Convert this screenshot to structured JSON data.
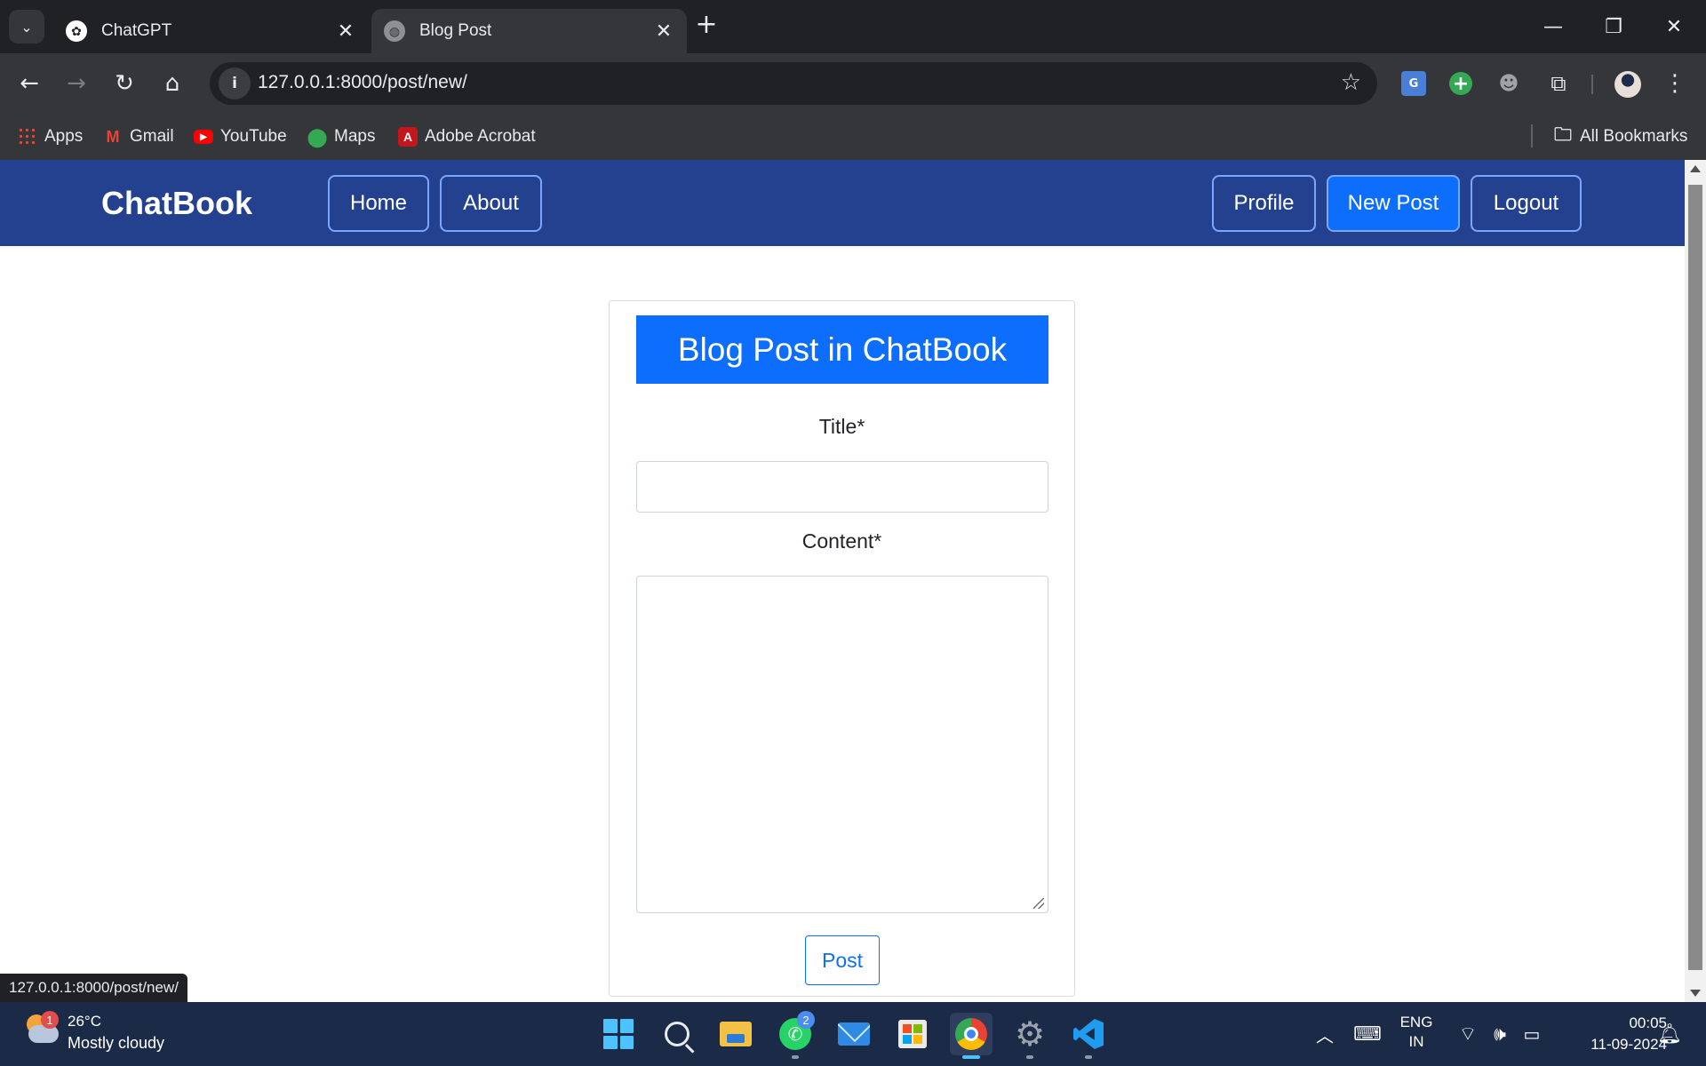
{
  "browser": {
    "tabs": [
      {
        "title": "ChatGPT",
        "favicon": "chatgpt-logo-icon",
        "active": false
      },
      {
        "title": "Blog Post",
        "favicon": "globe-icon",
        "active": true
      }
    ],
    "url": "127.0.0.1:8000/post/new/",
    "bookmarks": [
      {
        "label": "Apps",
        "icon": "apps-grid-icon"
      },
      {
        "label": "Gmail",
        "icon": "gmail-icon"
      },
      {
        "label": "YouTube",
        "icon": "youtube-icon"
      },
      {
        "label": "Maps",
        "icon": "maps-icon"
      },
      {
        "label": "Adobe Acrobat",
        "icon": "acrobat-icon"
      }
    ],
    "all_bookmarks": "All Bookmarks",
    "status_url": "127.0.0.1:8000/post/new/"
  },
  "app": {
    "brand": "ChatBook",
    "nav_left": [
      "Home",
      "About"
    ],
    "nav_right": [
      "Profile",
      "New Post",
      "Logout"
    ],
    "active_nav": "New Post",
    "colors": {
      "navbar": "#24418f",
      "primary": "#0d6efd"
    }
  },
  "form": {
    "header": "Blog Post in ChatBook",
    "title_label": "Title*",
    "title_value": "",
    "content_label": "Content*",
    "content_value": "",
    "submit_label": "Post"
  },
  "taskbar": {
    "weather": {
      "temp": "26°C",
      "desc": "Mostly cloudy",
      "badge": "1"
    },
    "whatsapp_badge": "2",
    "lang_line1": "ENG",
    "lang_line2": "IN",
    "time": "00:05",
    "date": "11-09-2024"
  }
}
